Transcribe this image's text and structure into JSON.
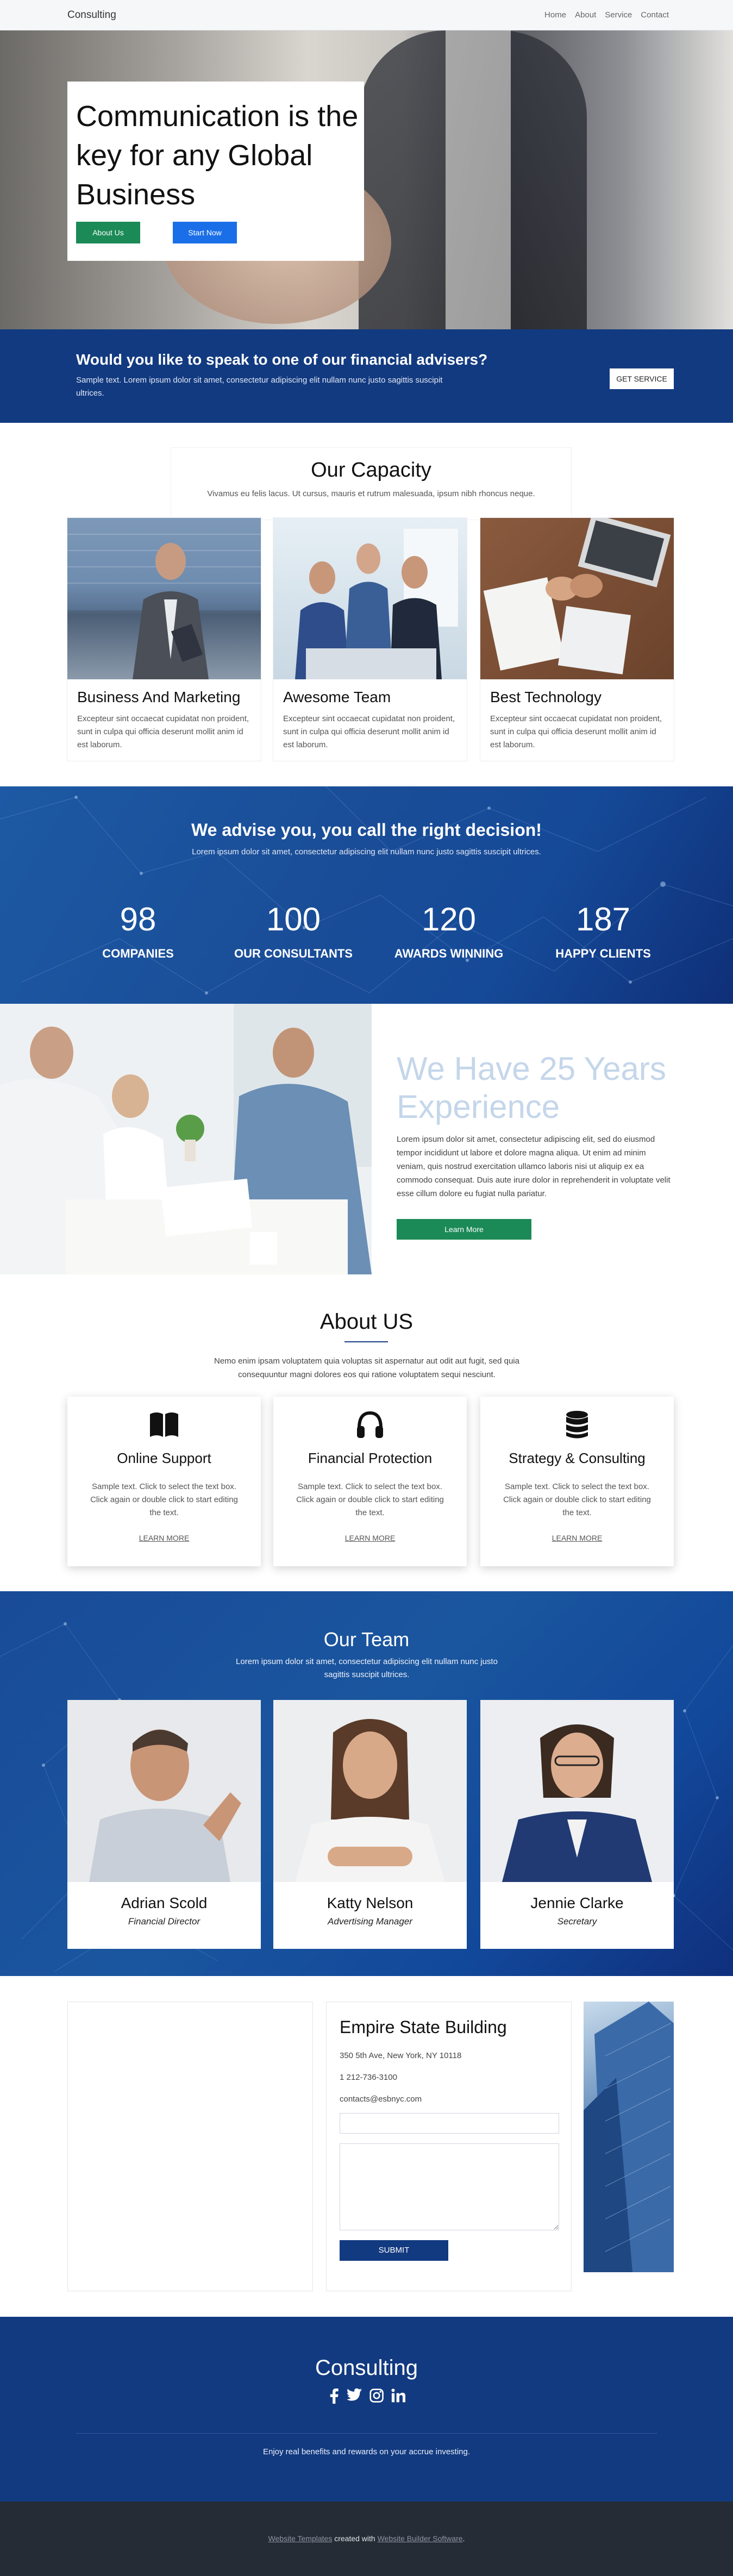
{
  "header": {
    "logo": "Consulting",
    "nav": [
      "Home",
      "About",
      "Service",
      "Contact"
    ]
  },
  "hero": {
    "title": "Communication is the key for any Global Business",
    "btn_about": "About Us",
    "btn_start": "Start Now"
  },
  "advisers": {
    "title": "Would you like to speak to one of our financial advisers?",
    "text": "Sample text. Lorem ipsum dolor sit amet, consectetur adipiscing elit nullam nunc justo sagittis suscipit ultrices.",
    "button": "GET SERVICE"
  },
  "capacity": {
    "title": "Our Capacity",
    "subtitle": "Vivamus eu felis lacus. Ut cursus, mauris et rutrum malesuada, ipsum nibh rhoncus neque.",
    "cards": [
      {
        "title": "Business And Marketing",
        "text": "Excepteur sint occaecat cupidatat non proident, sunt in culpa qui officia deserunt mollit anim id est laborum."
      },
      {
        "title": "Awesome Team",
        "text": "Excepteur sint occaecat cupidatat non proident, sunt in culpa qui officia deserunt mollit anim id est laborum."
      },
      {
        "title": "Best Technology",
        "text": "Excepteur sint occaecat cupidatat non proident, sunt in culpa qui officia deserunt mollit anim id est laborum."
      }
    ]
  },
  "stats": {
    "title": "We advise you, you call the right decision!",
    "subtitle": "Lorem ipsum dolor sit amet, consectetur adipiscing elit nullam nunc justo sagittis suscipit ultrices.",
    "items": [
      {
        "n": "98",
        "l": "COMPANIES"
      },
      {
        "n": "100",
        "l": "OUR CONSULTANTS"
      },
      {
        "n": "120",
        "l": "AWARDS WINNING"
      },
      {
        "n": "187",
        "l": "HAPPY CLIENTS"
      }
    ]
  },
  "experience": {
    "title": "We Have 25 Years Experience",
    "text": "Lorem ipsum dolor sit amet, consectetur adipiscing elit, sed do eiusmod tempor incididunt ut labore et dolore magna aliqua. Ut enim ad minim veniam, quis nostrud exercitation ullamco laboris nisi ut aliquip ex ea commodo consequat. Duis aute irure dolor in reprehenderit in voluptate velit esse cillum dolore eu fugiat nulla pariatur.",
    "button": "Learn More"
  },
  "about": {
    "title": "About US",
    "intro": "Nemo enim ipsam voluptatem quia voluptas sit aspernatur aut odit aut fugit, sed quia consequuntur magni dolores eos qui ratione voluptatem sequi nesciunt.",
    "cards": [
      {
        "icon": "book-icon",
        "title": "Online Support",
        "text": "Sample text. Click to select the text box. Click again or double click to start editing the text.",
        "link": "LEARN MORE"
      },
      {
        "icon": "headphones-icon",
        "title": "Financial Protection",
        "text": "Sample text. Click to select the text box. Click again or double click to start editing the text.",
        "link": "LEARN MORE"
      },
      {
        "icon": "database-icon",
        "title": "Strategy & Consulting",
        "text": "Sample text. Click to select the text box. Click again or double click to start editing the text.",
        "link": "LEARN MORE"
      }
    ]
  },
  "team": {
    "title": "Our Team",
    "subtitle": "Lorem ipsum dolor sit amet, consectetur adipiscing elit nullam nunc justo sagittis suscipit ultrices.",
    "members": [
      {
        "name": "Adrian Scold",
        "role": "Financial Director"
      },
      {
        "name": "Katty Nelson",
        "role": "Advertising Manager"
      },
      {
        "name": "Jennie Clarke",
        "role": "Secretary"
      }
    ]
  },
  "contact": {
    "title": "Empire State Building",
    "address": "350 5th Ave, New York, NY 10118",
    "phone": "1 212-736-3100",
    "email": "contacts@esbnyc.com",
    "submit": "SUBMIT"
  },
  "footer": {
    "title": "Consulting",
    "tagline": "Enjoy real benefits and rewards on your accrue investing.",
    "social": [
      "facebook-icon",
      "twitter-icon",
      "instagram-icon",
      "linkedin-icon"
    ]
  },
  "bottom": {
    "link1": "Website Templates",
    "mid": " created with ",
    "link2": "Website Builder Software",
    "end": "."
  },
  "colors": {
    "primary": "#123a80",
    "green": "#1b8a57",
    "blue": "#1a6fe8",
    "dark": "#262c35"
  }
}
